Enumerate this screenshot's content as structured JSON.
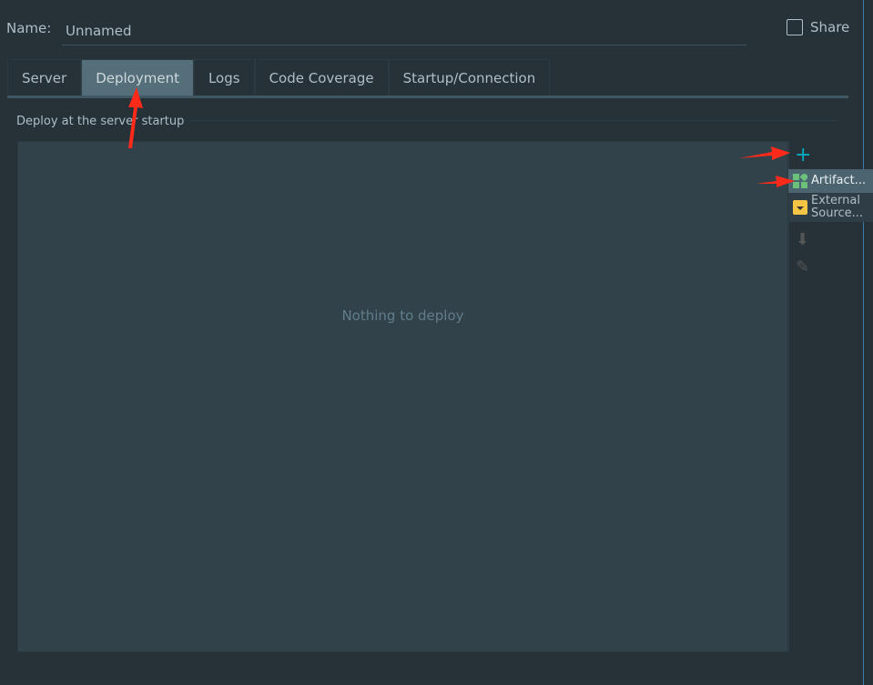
{
  "name": {
    "label": "Name:",
    "value": "Unnamed"
  },
  "share": {
    "label": "Share",
    "checked": false
  },
  "tabs": [
    {
      "label": "Server"
    },
    {
      "label": "Deployment",
      "active": true
    },
    {
      "label": "Logs"
    },
    {
      "label": "Code Coverage"
    },
    {
      "label": "Startup/Connection"
    }
  ],
  "section": {
    "title": "Deploy at the server startup",
    "empty_text": "Nothing to deploy"
  },
  "toolbar": {
    "add_icon": "plus-icon",
    "down_icon": "arrow-down-icon",
    "edit_icon": "pencil-icon"
  },
  "menu": {
    "items": [
      {
        "label": "Artifact...",
        "icon": "artifact-icon"
      },
      {
        "label": "External Source...",
        "icon": "external-source-icon"
      }
    ]
  },
  "colors": {
    "accent": "#00acc1",
    "active_tab": "#546e7a",
    "annotation": "#ff2a1a"
  }
}
